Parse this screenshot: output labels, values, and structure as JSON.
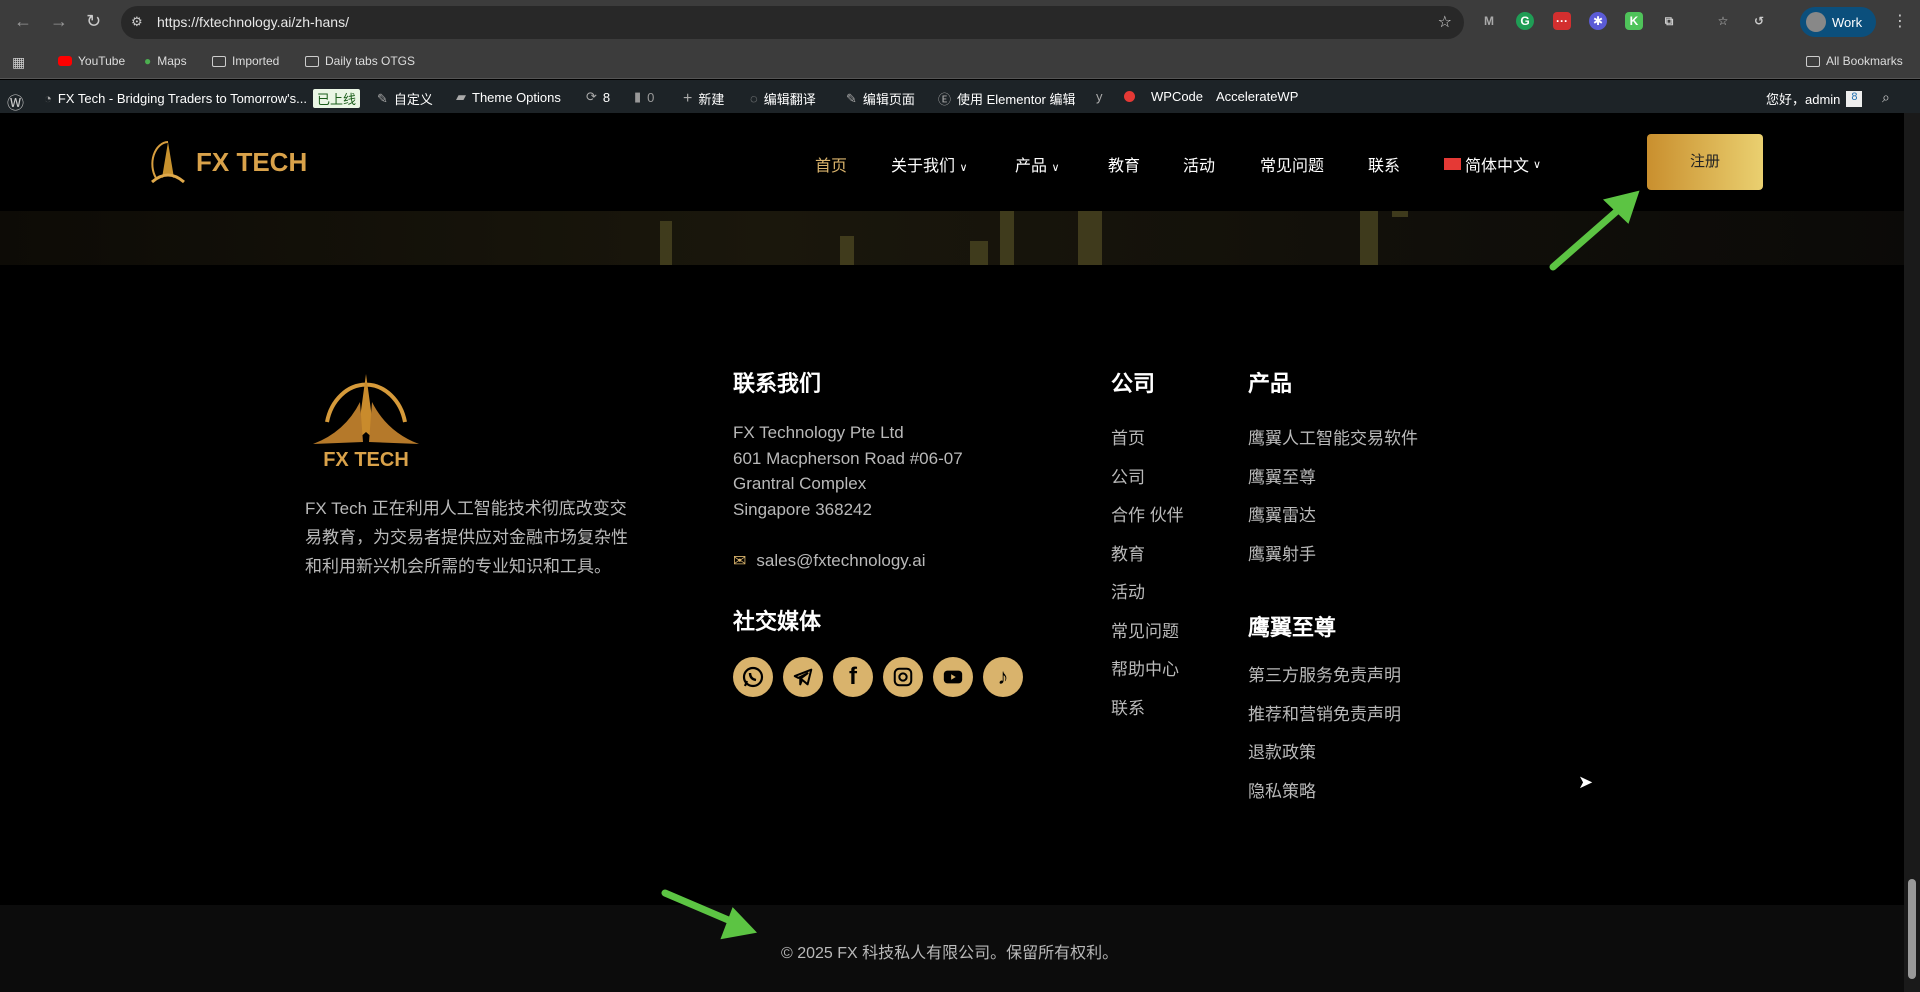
{
  "browser": {
    "url": "https://fxtechnology.ai/zh-hans/",
    "profile": "Work",
    "bookmarks": [
      "YouTube",
      "Maps",
      "Imported",
      "Daily tabs OTGS"
    ],
    "all_bookmarks": "All Bookmarks"
  },
  "wp_admin": {
    "site": "FX Tech - Bridging Traders to Tomorrow's...",
    "live_badge": "已上线",
    "customize": "自定义",
    "theme_options": "Theme Options",
    "updates": "8",
    "comments": "0",
    "new": "新建",
    "translate": "编辑翻译",
    "edit_page": "编辑页面",
    "elementor": "使用 Elementor 编辑",
    "wpcode": "WPCode",
    "accelerate": "AccelerateWP",
    "greeting": "您好，admin"
  },
  "header": {
    "logo": "FX TECH",
    "nav": [
      "首页",
      "关于我们",
      "产品",
      "教育",
      "活动",
      "常见问题",
      "联系"
    ],
    "language": "简体中文",
    "register": "注册"
  },
  "footer": {
    "logo": "FX TECH",
    "description": [
      "FX Tech 正在利用人工智能技术彻底改变交",
      "易教育，为交易者提供应对金融市场复杂性",
      "和利用新兴机会所需的专业知识和工具。"
    ],
    "contact": {
      "heading": "联系我们",
      "address": [
        "FX Technology Pte Ltd",
        "601 Macpherson Road #06-07",
        "Grantral Complex",
        "Singapore 368242"
      ],
      "email": "sales@fxtechnology.ai"
    },
    "social": {
      "heading": "社交媒体",
      "icons": [
        "whatsapp-icon",
        "telegram-icon",
        "facebook-icon",
        "instagram-icon",
        "youtube-icon",
        "tiktok-icon"
      ]
    },
    "company": {
      "heading": "公司",
      "items": [
        "首页",
        "公司",
        "合作 伙伴",
        "教育",
        "活动",
        "常见问题",
        "帮助中心",
        "联系"
      ]
    },
    "products": {
      "heading": "产品",
      "items": [
        "鹰翼人工智能交易软件",
        "鹰翼至尊",
        "鹰翼雷达",
        "鹰翼射手"
      ]
    },
    "legal": {
      "heading": "鹰翼至尊",
      "items": [
        "第三方服务免责声明",
        "推荐和营销免责声明",
        "退款政策",
        "隐私策略"
      ]
    },
    "copyright": "© 2025 FX 科技私人有限公司。保留所有权利。"
  },
  "colors": {
    "gold": "#d9b36c",
    "annotation": "#5cc443"
  }
}
